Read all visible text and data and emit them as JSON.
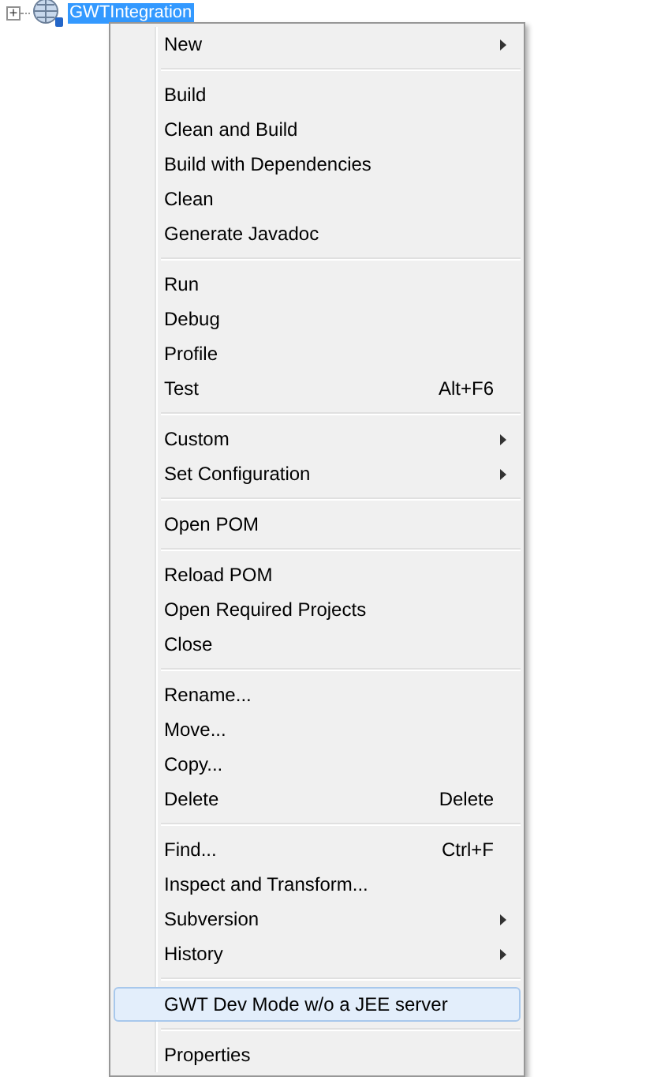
{
  "tree": {
    "expand_toggle": "+",
    "node": {
      "label": "GWTIntegration",
      "selected": true
    }
  },
  "context_menu": {
    "groups": [
      {
        "items": [
          {
            "label": "New",
            "submenu": true,
            "selected": false
          }
        ]
      },
      {
        "items": [
          {
            "label": "Build",
            "submenu": false,
            "selected": false
          },
          {
            "label": "Clean and Build",
            "submenu": false,
            "selected": false
          },
          {
            "label": "Build with Dependencies",
            "submenu": false,
            "selected": false
          },
          {
            "label": "Clean",
            "submenu": false,
            "selected": false
          },
          {
            "label": "Generate Javadoc",
            "submenu": false,
            "selected": false
          }
        ]
      },
      {
        "items": [
          {
            "label": "Run",
            "submenu": false,
            "selected": false
          },
          {
            "label": "Debug",
            "submenu": false,
            "selected": false
          },
          {
            "label": "Profile",
            "submenu": false,
            "selected": false
          },
          {
            "label": "Test",
            "shortcut": "Alt+F6",
            "submenu": false,
            "selected": false
          }
        ]
      },
      {
        "items": [
          {
            "label": "Custom",
            "submenu": true,
            "selected": false
          },
          {
            "label": "Set Configuration",
            "submenu": true,
            "selected": false
          }
        ]
      },
      {
        "items": [
          {
            "label": "Open POM",
            "submenu": false,
            "selected": false
          }
        ]
      },
      {
        "items": [
          {
            "label": "Reload POM",
            "submenu": false,
            "selected": false
          },
          {
            "label": "Open Required Projects",
            "submenu": false,
            "selected": false
          },
          {
            "label": "Close",
            "submenu": false,
            "selected": false
          }
        ]
      },
      {
        "items": [
          {
            "label": "Rename...",
            "submenu": false,
            "selected": false
          },
          {
            "label": "Move...",
            "submenu": false,
            "selected": false
          },
          {
            "label": "Copy...",
            "submenu": false,
            "selected": false
          },
          {
            "label": "Delete",
            "shortcut": "Delete",
            "submenu": false,
            "selected": false
          }
        ]
      },
      {
        "items": [
          {
            "label": "Find...",
            "shortcut": "Ctrl+F",
            "submenu": false,
            "selected": false
          },
          {
            "label": "Inspect and Transform...",
            "submenu": false,
            "selected": false
          },
          {
            "label": "Subversion",
            "submenu": true,
            "selected": false
          },
          {
            "label": "History",
            "submenu": true,
            "selected": false
          }
        ]
      },
      {
        "items": [
          {
            "label": "GWT Dev Mode w/o a JEE server",
            "submenu": false,
            "selected": true
          }
        ]
      },
      {
        "items": [
          {
            "label": "Properties",
            "submenu": false,
            "selected": false
          }
        ]
      }
    ]
  }
}
